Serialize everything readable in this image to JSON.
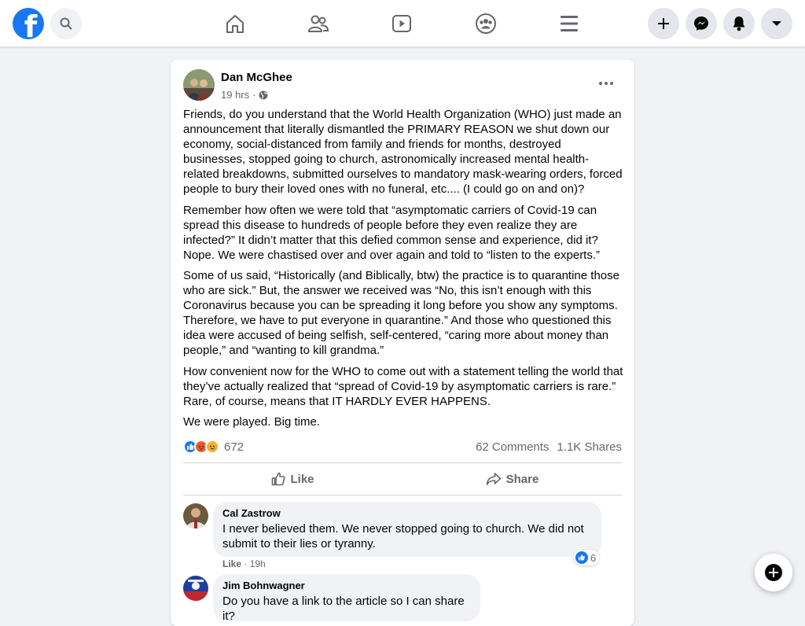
{
  "topbar": {
    "logo_letter": "f",
    "search_icon": "search-icon",
    "nav": [
      "home-icon",
      "friends-icon",
      "watch-icon",
      "groups-icon",
      "menu-icon"
    ],
    "right_buttons": [
      "create-plus-icon",
      "messenger-icon",
      "notifications-bell-icon",
      "account-caret-icon"
    ],
    "accent": "#1877f2"
  },
  "post": {
    "author": "Dan McGhee",
    "time": "19 hrs",
    "separator": "·",
    "privacy_icon": "globe-icon",
    "paragraphs": [
      "Friends, do you understand that the World Health Organization (WHO) just made an announcement that literally dismantled the PRIMARY REASON we shut down our economy, social-distanced from family and friends for months, destroyed businesses, stopped going to church, astronomically increased mental health-related breakdowns, submitted ourselves to mandatory mask-wearing orders, forced people to bury their loved ones with no funeral, etc.... (I could go on and on)?",
      "Remember how often we were told that “asymptomatic carriers of Covid-19 can spread this disease to hundreds of people before they even realize they are infected?” It didn’t matter that this defied common sense and experience, did it? Nope. We were chastised over and over again and told to “listen to the experts.”",
      "Some of us said, “Historically (and Biblically, btw) the practice is to quarantine those who are sick.” But, the answer we received was “No, this isn’t enough with this Coronavirus because you can be spreading it long before you show any symptoms. Therefore, we have to put everyone in quarantine.” And those who questioned this idea were accused of being selfish, self-centered, “caring more about money than people,” and “wanting to kill grandma.”",
      "How convenient now for the WHO to come out with a statement telling the world that they’ve actually realized that “spread of Covid-19 by asymptomatic carriers is rare.” Rare, of course, means that IT HARDLY EVER HAPPENS.",
      "We were played. Big time."
    ],
    "reactions": {
      "icons": [
        "like-reaction-icon",
        "angry-reaction-icon",
        "sad-reaction-icon"
      ],
      "count": "672",
      "comments": "62 Comments",
      "shares": "1.1K Shares"
    },
    "actions": {
      "like": "Like",
      "share": "Share"
    }
  },
  "comments": [
    {
      "name": "Cal Zastrow",
      "text": "I never believed them. We never stopped going to church. We did not submit to their lies or tyranny.",
      "like_label": "Like",
      "separator": "·",
      "time": "19h",
      "reaction_count": "6"
    },
    {
      "name": "Jim Bohnwagner",
      "text": "Do you have a link to the article so I can share it?"
    }
  ]
}
